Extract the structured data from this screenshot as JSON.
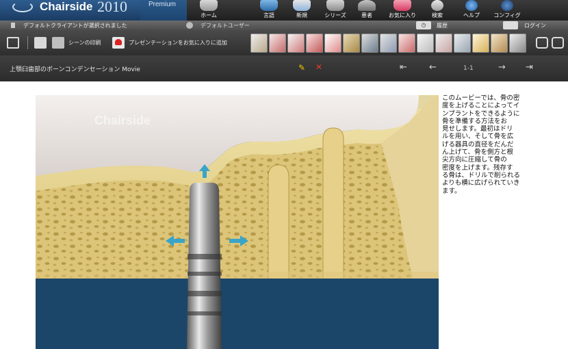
{
  "app": {
    "brand": "Chairside",
    "trademark": "®",
    "year": "2010",
    "edition": "Premium"
  },
  "nav": [
    {
      "label": "ホーム",
      "icon": "home-icon"
    },
    {
      "label": "言語",
      "icon": "language-icon"
    },
    {
      "label": "新規",
      "icon": "new-icon"
    },
    {
      "label": "シリーズ",
      "icon": "series-icon"
    },
    {
      "label": "患者",
      "icon": "patient-icon"
    },
    {
      "label": "お気に入り",
      "icon": "favorites-icon"
    },
    {
      "label": "検索",
      "icon": "search-icon"
    },
    {
      "label": "ヘルプ",
      "icon": "help-icon"
    },
    {
      "label": "コンフィグ",
      "icon": "config-icon"
    }
  ],
  "status": {
    "client": "デフォルトクライアントが選択されました",
    "user": "デフォルトユーザー",
    "history": "履歴",
    "login": "ログイン"
  },
  "toolbar": {
    "print_label": "シーンの印刷",
    "favorite_label": "プレゼンテーションをお気に入りに追加"
  },
  "titlebar": {
    "title": "上顎臼歯部のボーンコンデンセーション",
    "kind": "Movie",
    "page": "1-1"
  },
  "video": {
    "watermark": "Chairside"
  },
  "description": "このムービーでは、骨の密\n度を上げることによってイ\nンプラントをできるように\n骨を準備する方法をお\n見せします。最初はドリ\nルを用い、そして骨を広\nげる器具の直径をだんだ\nん上げて、骨を側方と根\n尖方向に圧縮して骨の\n密度を上げます。残存す\nる骨は、ドリルで削られる\nよりも横に広げられていき\nます。",
  "colors": {
    "accent": "#2f5d8f",
    "bone": "#e4cf8a",
    "background": "#1d4a6b",
    "arrow": "#3aa4c8"
  }
}
